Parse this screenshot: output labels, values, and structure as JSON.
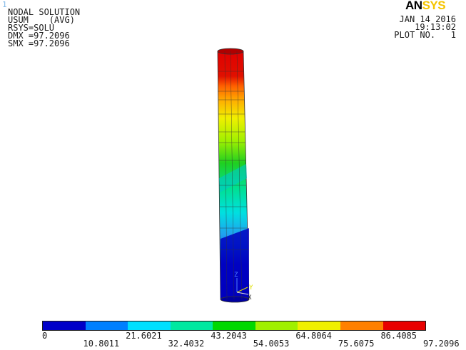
{
  "window_number": "1",
  "logo": {
    "an": "AN",
    "sys": "SYS"
  },
  "info": {
    "line1": "NODAL SOLUTION",
    "line2": "USUM    (AVG)",
    "line3": "RSYS=SOLU",
    "line4": "DMX =97.2096",
    "line5": "SMX =97.2096"
  },
  "date": {
    "date": "JAN 14 2016",
    "time": "19:13:02",
    "plot": "PLOT NO.   1"
  },
  "triad": {
    "z": "Z",
    "y": "Y",
    "x": "X"
  },
  "legend": {
    "colors": [
      "#0000c8",
      "#0080ff",
      "#00e0ff",
      "#00e8a0",
      "#00d800",
      "#a0f000",
      "#f0f000",
      "#ff8000",
      "#e80000"
    ],
    "labels": [
      "0",
      "10.8011",
      "21.6021",
      "32.4032",
      "43.2043",
      "54.0053",
      "64.8064",
      "75.6075",
      "86.4085",
      "97.2096"
    ]
  },
  "colors": {
    "background": "#ffffff",
    "outline": "#1a1a1a"
  }
}
